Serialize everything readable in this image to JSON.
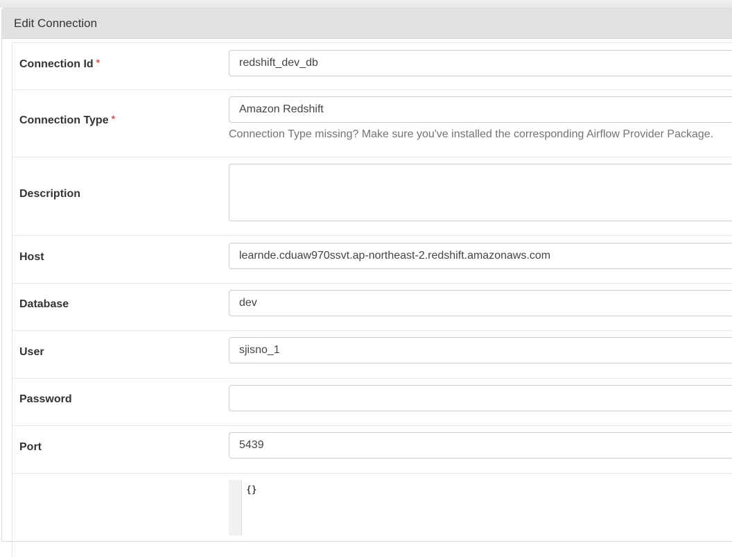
{
  "panel": {
    "title": "Edit Connection"
  },
  "fields": {
    "conn_id": {
      "label": "Connection Id",
      "required_mark": "*",
      "value": "redshift_dev_db"
    },
    "conn_type": {
      "label": "Connection Type",
      "required_mark": "*",
      "value": "Amazon Redshift",
      "help": "Connection Type missing? Make sure you've installed the corresponding Airflow Provider Package."
    },
    "description": {
      "label": "Description",
      "value": ""
    },
    "host": {
      "label": "Host",
      "value": "learnde.cduaw970ssvt.ap-northeast-2.redshift.amazonaws.com"
    },
    "database": {
      "label": "Database",
      "value": "dev"
    },
    "user": {
      "label": "User",
      "value": "sjisno_1"
    },
    "password": {
      "label": "Password",
      "value": ""
    },
    "port": {
      "label": "Port",
      "value": "5439"
    },
    "extra": {
      "label": "",
      "value": "{}"
    }
  },
  "colors": {
    "required": "#d9534f",
    "heading_bg": "#e2e2e2"
  }
}
